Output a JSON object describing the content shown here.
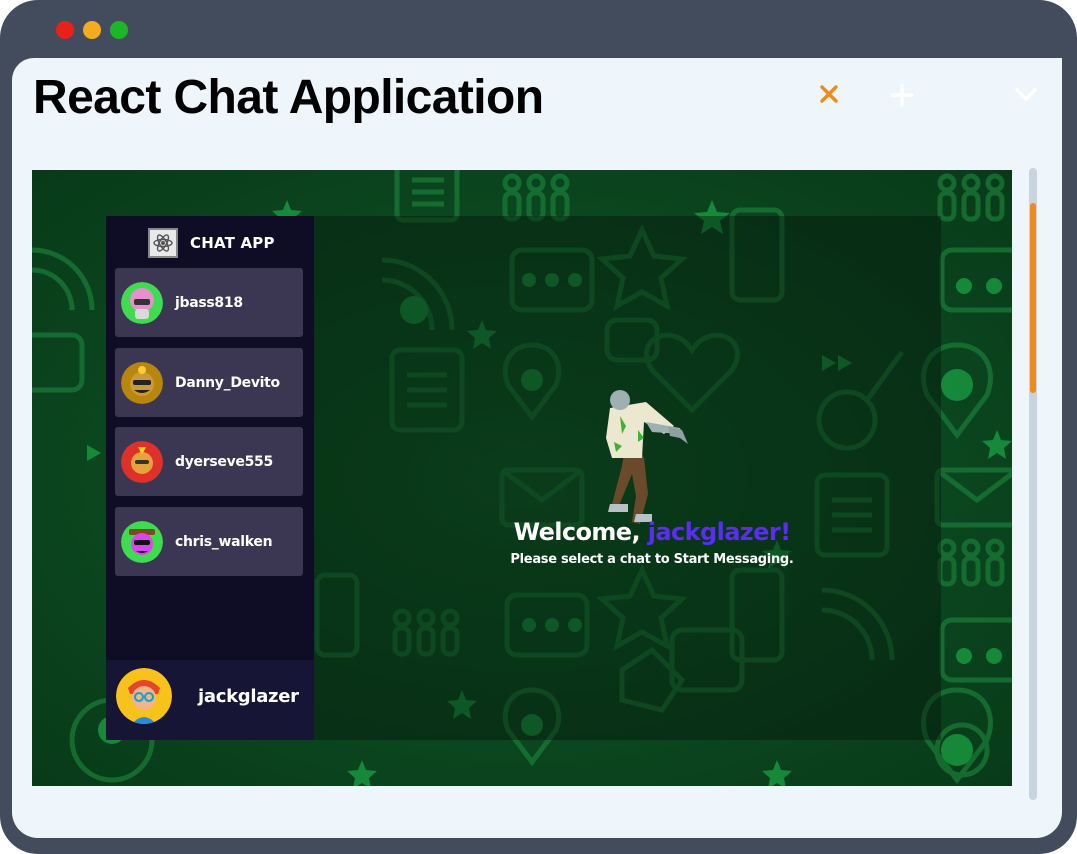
{
  "window": {
    "tab_title": "React Chat Application",
    "traffic_lights": {
      "close": "#e8221b",
      "minimize": "#f3ad1c",
      "maximize": "#1db627"
    },
    "tab_close_icon": "close-icon",
    "new_tab_icon": "plus-icon",
    "tab_menu_icon": "chevron-down-icon",
    "accent": "#f08a1a"
  },
  "app": {
    "brand": "CHAT APP",
    "contacts": [
      {
        "name": "jbass818"
      },
      {
        "name": "Danny_Devito"
      },
      {
        "name": "dyerseve555"
      },
      {
        "name": "chris_walken"
      }
    ],
    "current_user": "jackglazer",
    "welcome": {
      "prefix": "Welcome,",
      "username": "jackglazer!",
      "subtitle": "Please select a chat to Start Messaging."
    }
  }
}
